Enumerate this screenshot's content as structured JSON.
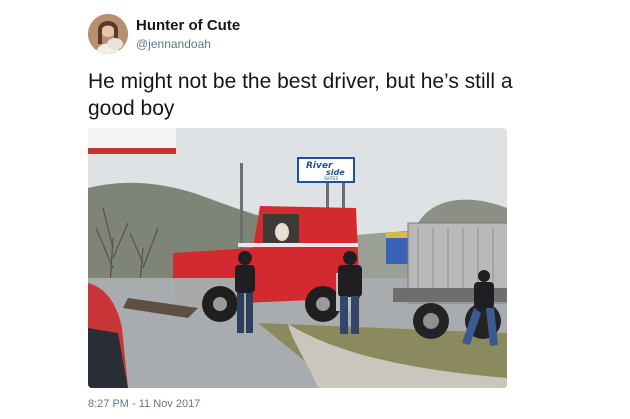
{
  "author": {
    "display_name": "Hunter of Cute",
    "handle": "@jennandoah"
  },
  "tweet": {
    "text": "He might not be the best driver, but he’s still a good boy",
    "timestamp": "8:27 PM - 11 Nov 2017"
  },
  "photo": {
    "sign_line1": "River",
    "sign_line2": "side",
    "sign_line3": "SUITES",
    "colors": {
      "truck_cab": "#d42a2f",
      "sign_blue": "#1f4fa3",
      "sky": "#dfe2e4",
      "road": "#a9acae"
    }
  },
  "colors": {
    "text_primary": "#14171a",
    "text_secondary": "#657786"
  }
}
